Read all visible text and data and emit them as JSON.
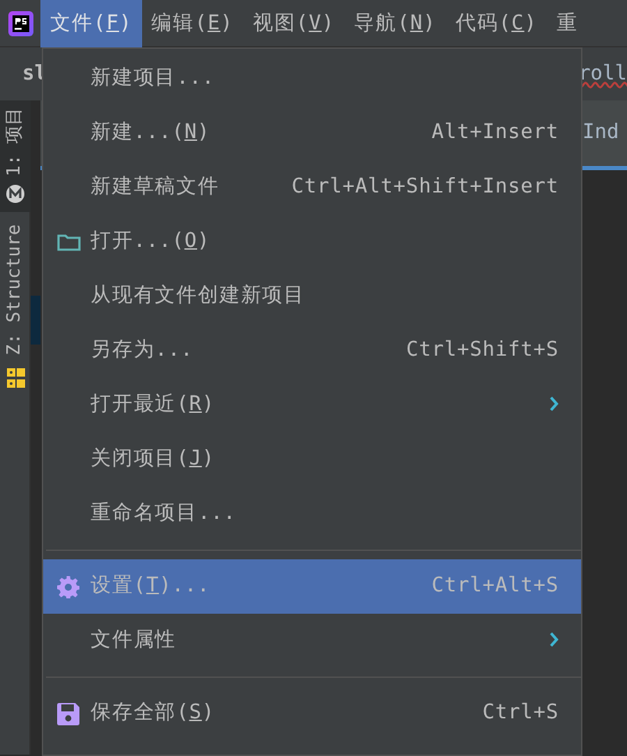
{
  "menubar": {
    "items": [
      {
        "label": "文件(",
        "mnemonic": "F",
        "suffix": ")",
        "selected": true
      },
      {
        "label": "编辑(",
        "mnemonic": "E",
        "suffix": ")",
        "selected": false
      },
      {
        "label": "视图(",
        "mnemonic": "V",
        "suffix": ")",
        "selected": false
      },
      {
        "label": "导航(",
        "mnemonic": "N",
        "suffix": ")",
        "selected": false
      },
      {
        "label": "代码(",
        "mnemonic": "C",
        "suffix": ")",
        "selected": false
      },
      {
        "label": "重",
        "selected": false
      }
    ]
  },
  "editor": {
    "tab_left": "sl",
    "tab_right": "roll",
    "field_text": "Ind"
  },
  "tool_windows": [
    {
      "label": "1: 项目",
      "selected": true
    },
    {
      "label": "Z: Structure",
      "selected": false
    }
  ],
  "file_menu": [
    {
      "kind": "item",
      "label": "新建项目...",
      "selected": false
    },
    {
      "kind": "item",
      "label": "新建...(",
      "mnemonic": "N",
      "suffix": ")",
      "shortcut": "Alt+Insert",
      "selected": false
    },
    {
      "kind": "item",
      "label": "新建草稿文件",
      "shortcut": "Ctrl+Alt+Shift+Insert",
      "selected": false
    },
    {
      "kind": "item",
      "label": "打开...(",
      "mnemonic": "O",
      "suffix": ")",
      "selected": false
    },
    {
      "kind": "item",
      "label": "从现有文件创建新项目",
      "selected": false
    },
    {
      "kind": "item",
      "label": "另存为...",
      "shortcut": "Ctrl+Shift+S",
      "selected": false
    },
    {
      "kind": "item",
      "label": "打开最近(",
      "mnemonic": "R",
      "suffix": ")",
      "submenu": true,
      "selected": false
    },
    {
      "kind": "item",
      "label": "关闭项目(",
      "mnemonic": "J",
      "suffix": ")",
      "selected": false
    },
    {
      "kind": "item",
      "label": "重命名项目...",
      "selected": false
    },
    {
      "kind": "separator"
    },
    {
      "kind": "item",
      "label": "设置(",
      "mnemonic": "T",
      "suffix": ")...",
      "shortcut": "Ctrl+Alt+S",
      "selected": true
    },
    {
      "kind": "item",
      "label": "文件属性",
      "submenu": true,
      "selected": false
    },
    {
      "kind": "separator"
    },
    {
      "kind": "item",
      "label": "保存全部(",
      "mnemonic": "S",
      "suffix": ")",
      "shortcut": "Ctrl+S",
      "selected": false
    }
  ]
}
